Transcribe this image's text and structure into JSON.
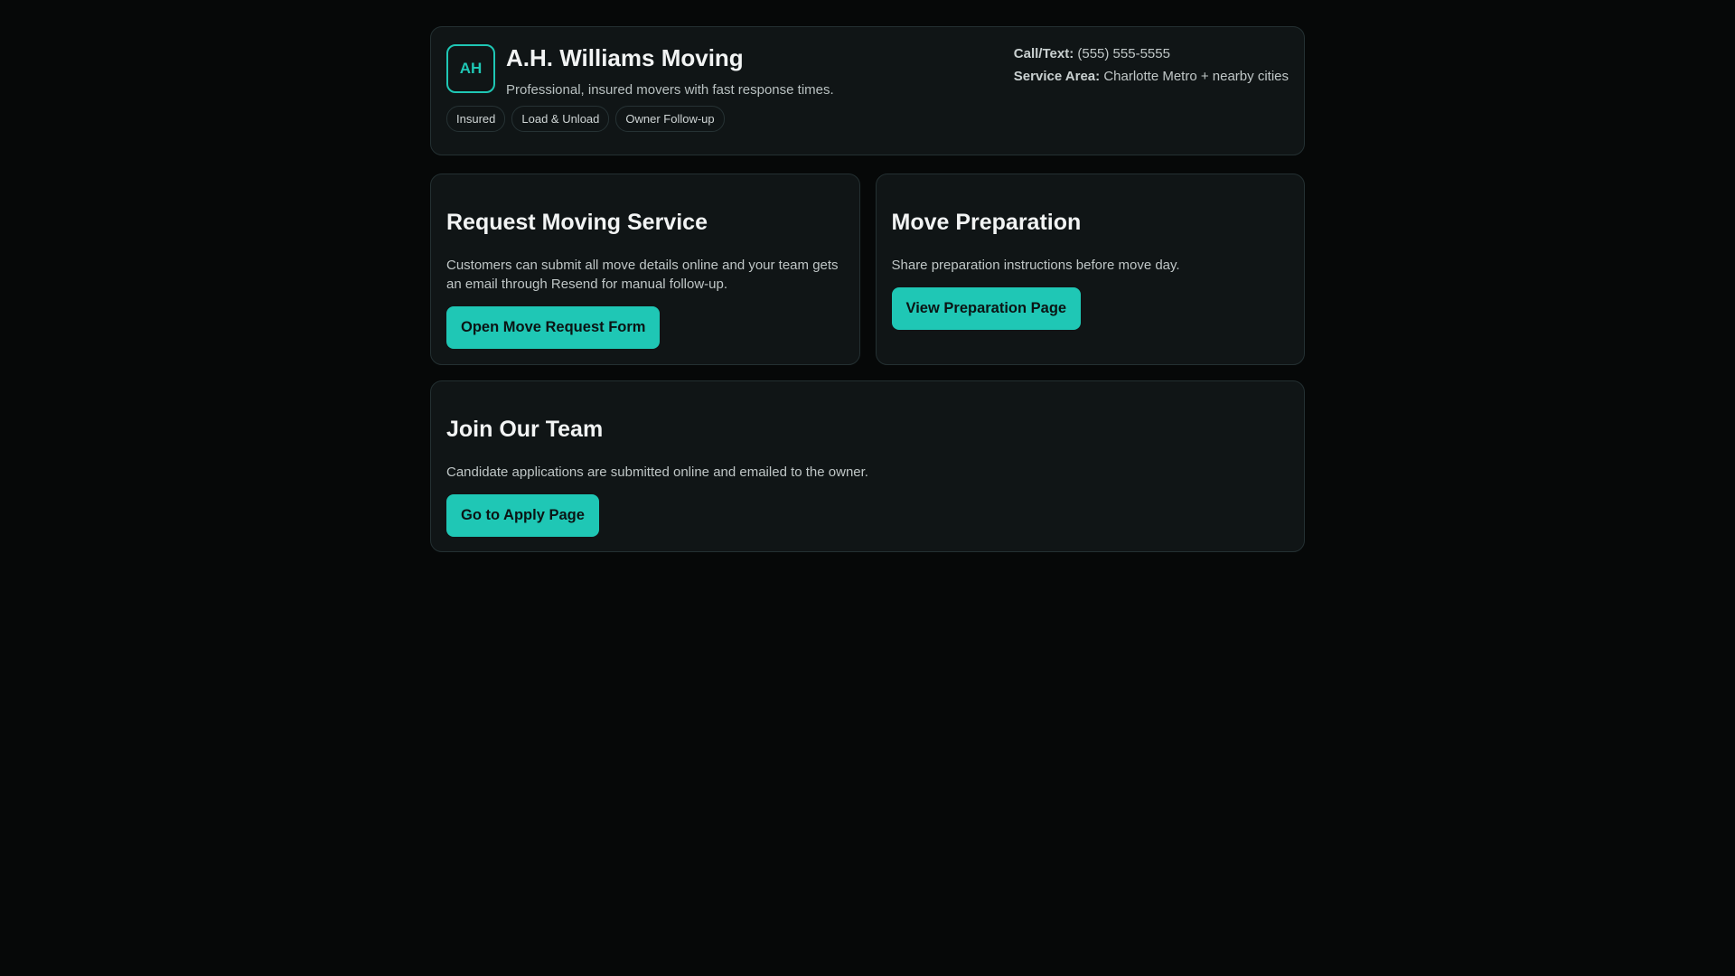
{
  "header": {
    "logo": "AH",
    "title": "A.H. Williams Moving",
    "tagline": "Professional, insured movers with fast response times.",
    "tags": [
      "Insured",
      "Load & Unload",
      "Owner Follow-up"
    ],
    "call_label": "Call/Text:",
    "call_value": "(555) 555-5555",
    "area_label": "Service Area:",
    "area_value": "Charlotte Metro + nearby cities"
  },
  "cards": [
    {
      "title": "Request Moving Service",
      "text": "Customers can submit all move details online and your team gets an email through Resend for manual follow-up.",
      "button": "Open Move Request Form"
    },
    {
      "title": "Move Preparation",
      "text": "Share preparation instructions before move day.",
      "button": "View Preparation Page"
    },
    {
      "title": "Join Our Team",
      "text": "Candidate applications are submitted online and emailed to the owner.",
      "button": "Go to Apply Page"
    }
  ],
  "colors": {
    "accent": "#1fc7b5",
    "background": "#060808",
    "card": "#101516"
  }
}
